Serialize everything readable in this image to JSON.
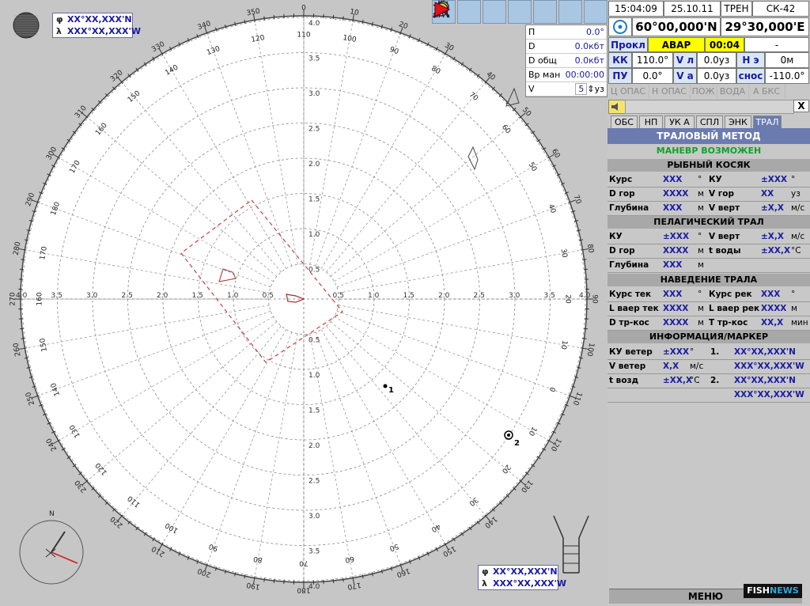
{
  "ownpos": {
    "lat": "XX°XX,XXX'N",
    "lon": "XXX°XX,XXX'W"
  },
  "cursorpos": {
    "lat": "XX°XX,XXX'N",
    "lon": "XXX°XX,XXX'W"
  },
  "lat_sym": "φ",
  "lon_sym": "λ",
  "stats": [
    {
      "k": "П",
      "v": "0.0°"
    },
    {
      "k": "D",
      "v": "0.0кбт"
    },
    {
      "k": "D общ",
      "v": "0.0кбт"
    },
    {
      "k": "Вр ман",
      "v": "00:00:00"
    },
    {
      "k": "V",
      "v": "5",
      "u": "уз"
    }
  ],
  "header": {
    "time": "15:04:09",
    "date": "25.10.11",
    "mode": "ТРЕН",
    "ship": "СК-42",
    "lat": "60°00,000'N",
    "lon": "29°30,000'E"
  },
  "state": {
    "prokl": "Прокл",
    "avar": "АВАР",
    "timer": "00:04",
    "dash": "-"
  },
  "nav": {
    "kk_l": "КК",
    "kk": "110.0°",
    "vl_l": "V л",
    "vl": "0.0уз",
    "he_l": "Н э",
    "he": "0м",
    "pu_l": "ПУ",
    "pu": "0.0°",
    "va_l": "V а",
    "va": "0.0уз",
    "snos_l": "снос",
    "snos": "-110.0°"
  },
  "alarms": [
    "Ц ОПАС",
    "Н ОПАС",
    "ПОЖ",
    "ВОДА",
    "А БКС"
  ],
  "close": "X",
  "tabs": [
    "ОБС",
    "НП",
    "УК А",
    "СПЛ",
    "ЭНК",
    "ТРАЛ"
  ],
  "title": "ТРАЛОВЫЙ МЕТОД",
  "maneuver": "МАНЕВР ВОЗМОЖЕН",
  "sections": {
    "school": "РЫБНЫЙ КОСЯК",
    "pelagic": "ПЕЛАГИЧЕСКИЙ ТРАЛ",
    "guidance": "НАВЕДЕНИЕ ТРАЛА",
    "info": "ИНФОРМАЦИЯ/МАРКЕР"
  },
  "school": [
    {
      "k1": "Курс",
      "v1": "XXX",
      "u1": "°",
      "k2": "КУ",
      "v2": "±XXX",
      "u2": "°"
    },
    {
      "k1": "D гор",
      "v1": "XXXX",
      "u1": "м",
      "k2": "V гор",
      "v2": "XX",
      "u2": "уз"
    },
    {
      "k1": "Глубина",
      "v1": "XXX",
      "u1": "м",
      "k2": "V верт",
      "v2": "±X,X",
      "u2": "м/с"
    }
  ],
  "pelagic": [
    {
      "k1": "КУ",
      "v1": "±XXX",
      "u1": "°",
      "k2": "V верт",
      "v2": "±X,X",
      "u2": "м/с"
    },
    {
      "k1": "D гор",
      "v1": "XXXX",
      "u1": "м",
      "k2": "t воды",
      "v2": "±XX,X",
      "u2": "°С"
    },
    {
      "k1": "Глубина",
      "v1": "XXX",
      "u1": "м",
      "k2": "",
      "v2": "",
      "u2": ""
    }
  ],
  "guidance": [
    {
      "k1": "Курс тек",
      "v1": "XXX",
      "u1": "°",
      "k2": "Курс рек",
      "v2": "XXX",
      "u2": "°"
    },
    {
      "k1": "L ваер тек",
      "v1": "XXXX",
      "u1": "м",
      "k2": "L ваер рек",
      "v2": "XXXX",
      "u2": "м"
    },
    {
      "k1": "D тр-кос",
      "v1": "XXXX",
      "u1": "м",
      "k2": "Т тр-кос",
      "v2": "XX,X",
      "u2": "мин"
    }
  ],
  "info": [
    {
      "k1": "КУ ветер",
      "v1": "±XXX",
      "u1": "°",
      "n": "1.",
      "c": "XX°XX,XXX'N"
    },
    {
      "k1": "V ветер",
      "v1": "X,X",
      "u1": "м/с",
      "n": "",
      "c": "XXX°XX,XXX'W"
    },
    {
      "k1": "t возд",
      "v1": "±XX,X",
      "u1": "°С",
      "n": "2.",
      "c": "XX°XX,XXX'N"
    },
    {
      "k1": "",
      "v1": "",
      "u1": "",
      "n": "",
      "c": "XXX°XX,XXX'W"
    }
  ],
  "menu": "МЕНЮ",
  "logo_a": "FISH",
  "logo_b": "NEWS",
  "radar": {
    "range_labels": [
      "0.5",
      "1.0",
      "1.5",
      "2.0",
      "2.5",
      "3.0",
      "3.5",
      "4.0"
    ],
    "bearing_labels": [
      "0",
      "10",
      "20",
      "30",
      "40",
      "50",
      "60",
      "70",
      "80",
      "90",
      "100",
      "110",
      "120",
      "130",
      "140",
      "150",
      "160",
      "170",
      "180",
      "190",
      "200",
      "210",
      "220",
      "230",
      "240",
      "250",
      "260",
      "270",
      "280",
      "290",
      "300",
      "310",
      "320",
      "330",
      "340",
      "350"
    ],
    "inner_labels": [
      "110",
      "100",
      "90",
      "80",
      "70",
      "60",
      "50",
      "40",
      "30",
      "20",
      "10",
      "0",
      "10",
      "20",
      "30",
      "40",
      "50",
      "60",
      "70",
      "80",
      "90",
      "100",
      "110",
      "120",
      "130",
      "140",
      "150",
      "160",
      "170",
      "180",
      "170",
      "160",
      "150",
      "140",
      "130",
      "120"
    ],
    "marker1": "1",
    "marker2": "2",
    "compass_n": "N"
  }
}
